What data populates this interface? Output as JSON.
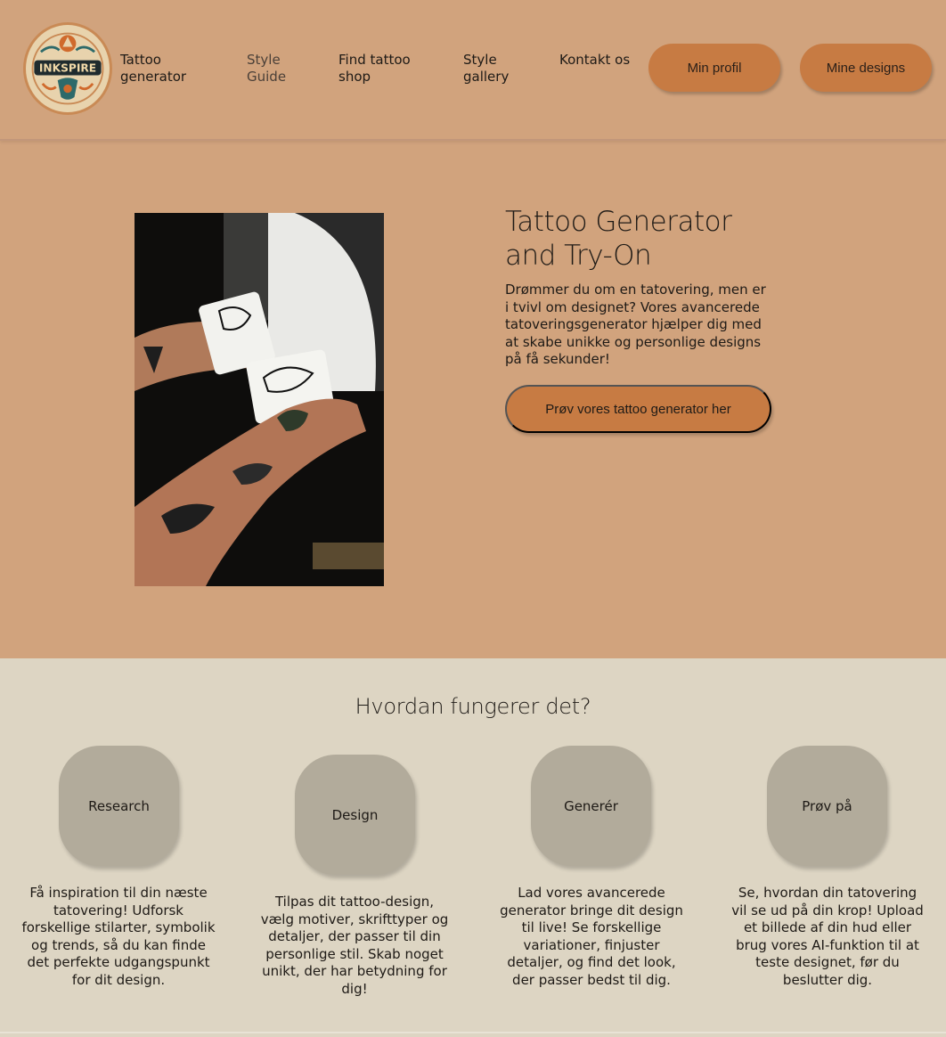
{
  "header": {
    "logo_icon": "inkspire-logo-icon",
    "logo_text": "INKSPIRE",
    "nav": [
      {
        "label": "Tattoo generator"
      },
      {
        "label": "Style Guide"
      },
      {
        "label": "Find tattoo shop"
      },
      {
        "label": "Style gallery"
      },
      {
        "label": "Kontakt os"
      }
    ],
    "buttons": {
      "profile": "Min profil",
      "designs": "Mine designs"
    }
  },
  "hero": {
    "title": "Tattoo Generator and Try-On",
    "description": "Drømmer du om en tatovering, men er i tvivl om designet? Vores avancerede tatoveringsgenerator hjælper dig med at skabe unikke og personlige designs på få sekunder!",
    "cta": "Prøv vores tattoo generator her"
  },
  "how": {
    "title": "Hvordan fungerer det?",
    "steps": [
      {
        "label": "Research",
        "text": "Få inspiration til din næste tatovering! Udforsk forskellige stilarter, symbolik og trends, så du kan finde det perfekte udgangspunkt for dit design."
      },
      {
        "label": "Design",
        "text": "Tilpas dit tattoo-design, vælg motiver, skrifttyper og detaljer, der passer til din personlige stil. Skab noget unikt, der har betydning for dig!"
      },
      {
        "label": "Generér",
        "text": "Lad vores avancerede generator bringe dit design til live! Se forskellige variationer, finjuster detaljer, og find det look, der passer bedst til dig."
      },
      {
        "label": "Prøv på",
        "text": "Se, hvordan din tatovering vil se ud på din krop! Upload et billede af din hud eller brug vores AI-funktion til at teste designet, før du beslutter dig."
      }
    ]
  },
  "colors": {
    "background": "#d1a37d",
    "button": "#c77b43",
    "section": "#ddd5c3",
    "step_circle": "#b2ab9b"
  }
}
